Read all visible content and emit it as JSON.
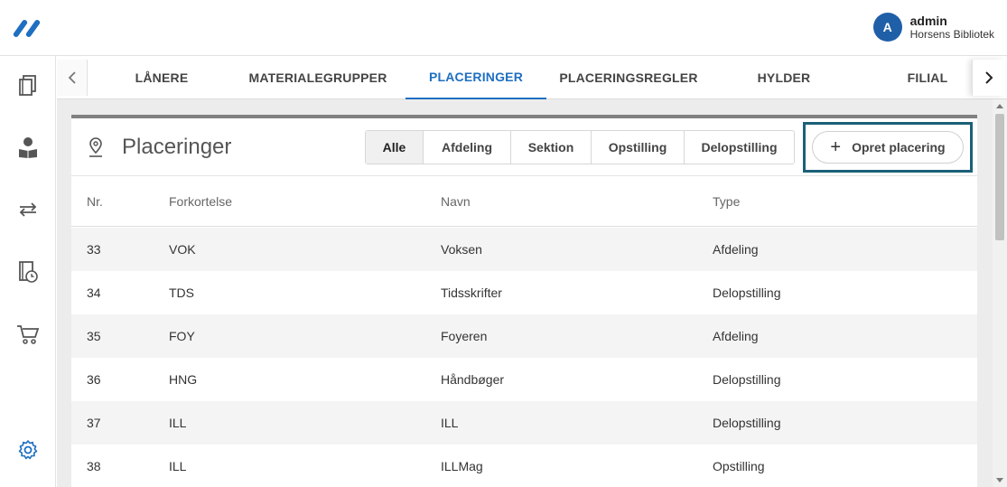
{
  "header": {
    "user": {
      "initial": "A",
      "name": "admin",
      "library": "Horsens Bibliotek"
    }
  },
  "sidebar": {
    "items": [
      {
        "icon": "books-icon"
      },
      {
        "icon": "reader-icon"
      },
      {
        "icon": "exchange-icon"
      },
      {
        "icon": "book-clock-icon"
      },
      {
        "icon": "cart-icon"
      },
      {
        "icon": "gear-icon"
      }
    ]
  },
  "tabs": {
    "items": [
      "LÅNERE",
      "MATERIALEGRUPPER",
      "PLACERINGER",
      "PLACERINGSREGLER",
      "HYLDER",
      "FILIAL"
    ],
    "active": "PLACERINGER"
  },
  "panel": {
    "title": "Placeringer",
    "filters": [
      "Alle",
      "Afdeling",
      "Sektion",
      "Opstilling",
      "Delopstilling"
    ],
    "active_filter": "Alle",
    "create_button": "Opret placering"
  },
  "table": {
    "columns": [
      "Nr.",
      "Forkortelse",
      "Navn",
      "Type"
    ],
    "rows": [
      [
        "33",
        "VOK",
        "Voksen",
        "Afdeling"
      ],
      [
        "34",
        "TDS",
        "Tidsskrifter",
        "Delopstilling"
      ],
      [
        "35",
        "FOY",
        "Foyeren",
        "Afdeling"
      ],
      [
        "36",
        "HNG",
        "Håndbøger",
        "Delopstilling"
      ],
      [
        "37",
        "ILL",
        "ILL",
        "Delopstilling"
      ],
      [
        "38",
        "ILL",
        "ILLMag",
        "Opstilling"
      ]
    ]
  },
  "colors": {
    "accent": "#1f6fc1",
    "highlight_outline": "#1b6077",
    "avatar": "#1f5fa8"
  }
}
